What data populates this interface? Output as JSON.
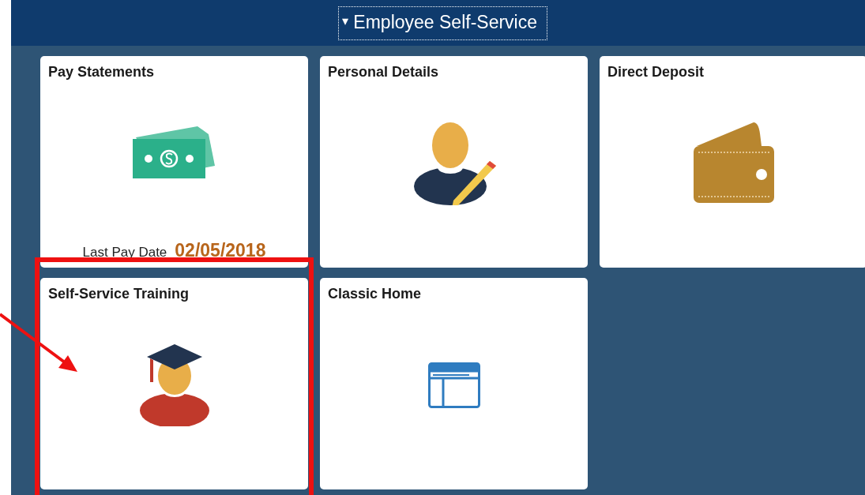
{
  "header": {
    "caret": "▾",
    "title": "Employee Self-Service"
  },
  "tiles": [
    {
      "title": "Pay Statements",
      "footer": {
        "label": "Last Pay Date",
        "value": "02/05/2018"
      }
    },
    {
      "title": "Personal Details"
    },
    {
      "title": "Direct Deposit"
    },
    {
      "title": "Self-Service Training"
    },
    {
      "title": "Classic Home"
    }
  ]
}
